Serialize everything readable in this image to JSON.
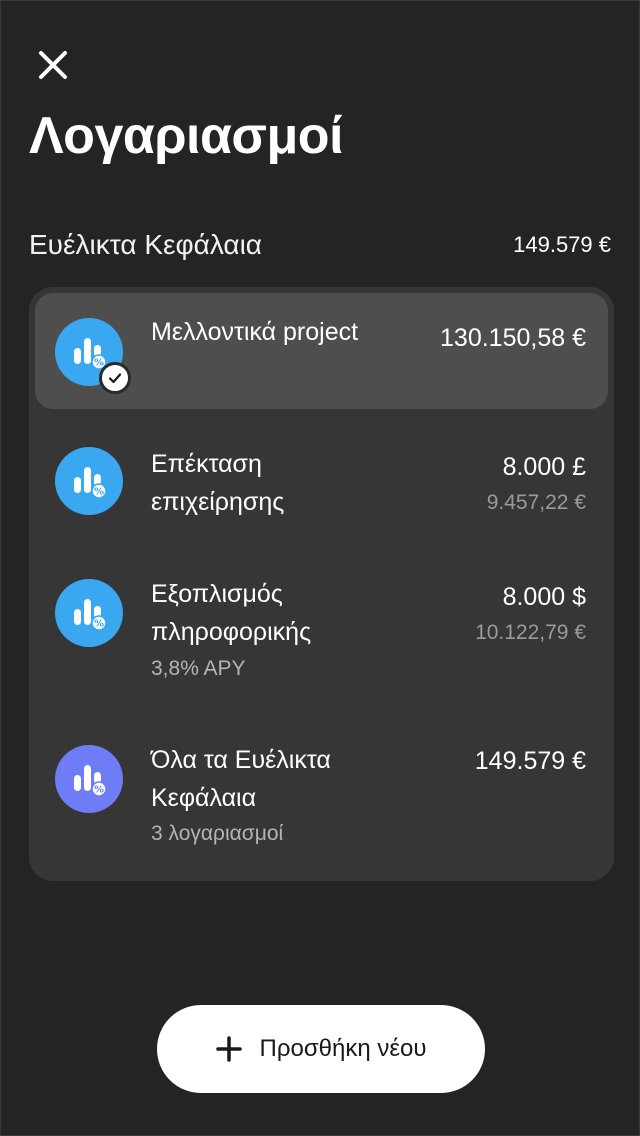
{
  "header": {
    "close_icon": "close-icon",
    "title": "Λογαριασμοί"
  },
  "section": {
    "title": "Ευέλικτα Κεφάλαια",
    "total": "149.579 €"
  },
  "accounts": [
    {
      "name": "Μελλοντικά project",
      "amount": "130.150,58 €",
      "converted": "",
      "subtitle": "",
      "selected": true,
      "icon": "savings-chart-icon",
      "color": "#3aa8f0"
    },
    {
      "name": "Επέκταση επιχείρησης",
      "amount": "8.000 £",
      "converted": "9.457,22 €",
      "subtitle": "",
      "selected": false,
      "icon": "savings-chart-icon",
      "color": "#3aa8f0"
    },
    {
      "name": "Εξοπλισμός πληροφορικής",
      "amount": "8.000 $",
      "converted": "10.122,79 €",
      "subtitle": "3,8% APY",
      "selected": false,
      "icon": "savings-chart-icon",
      "color": "#3aa8f0"
    },
    {
      "name": "Όλα τα Ευέλικτα Κεφάλαια",
      "amount": "149.579 €",
      "converted": "",
      "subtitle": "3 λογαριασμοί",
      "selected": false,
      "icon": "savings-chart-icon",
      "color": "#6e7cf5"
    }
  ],
  "add_button": {
    "label": "Προσθήκη νέου",
    "icon": "plus-icon"
  },
  "colors": {
    "background": "#242424",
    "card": "#363636",
    "selected_row": "#4e4e4e",
    "accent_blue": "#3aa8f0",
    "accent_purple": "#6e7cf5"
  }
}
